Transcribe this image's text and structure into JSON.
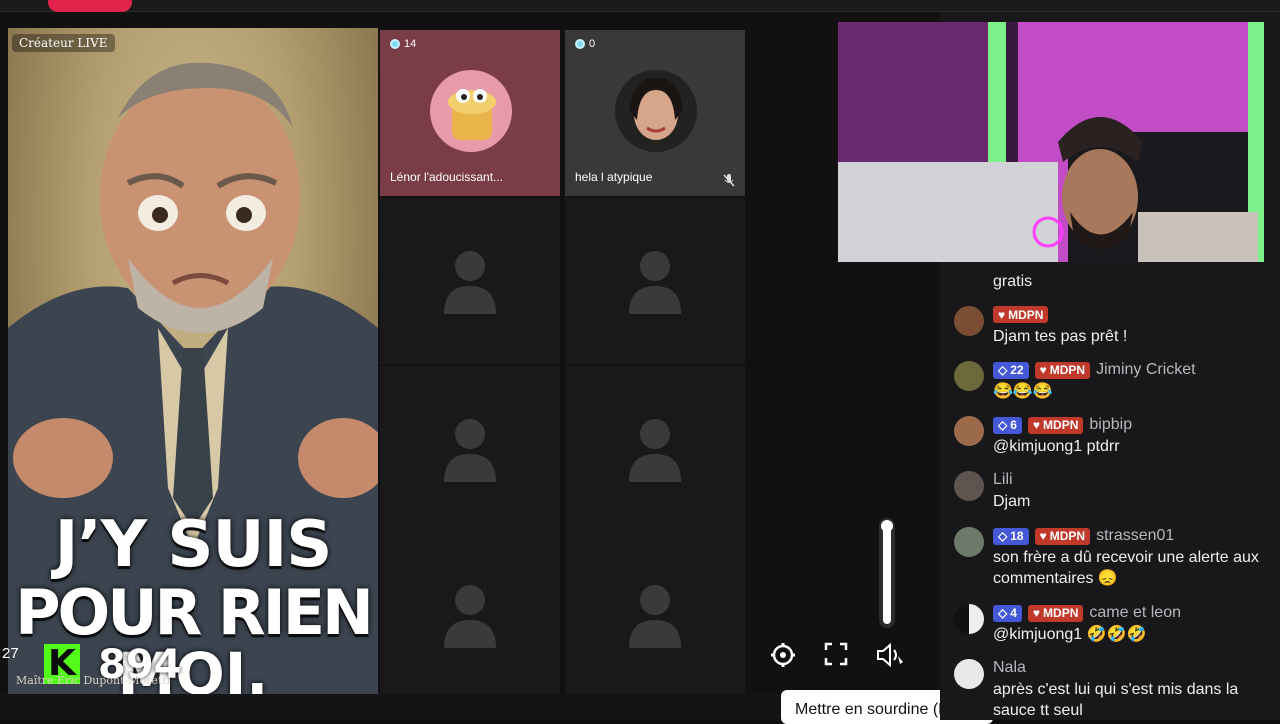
{
  "stage": {
    "host_label": "Créateur LIVE",
    "host_caption_line1": "J’Y SUIS",
    "host_caption_line2": "POUR RIEN",
    "host_caption_line3": "MOI.",
    "score": "27",
    "k_badge": "K",
    "viewers": "894",
    "host_name": "Maître Éric Dupont-Moretti",
    "guests": [
      {
        "count": "14",
        "name": "Lénor l'adoucissant..."
      },
      {
        "count": "0",
        "name": "hela l atypique"
      }
    ],
    "volume_level": 1.0,
    "tooltip": "Mettre en sourdine (M)",
    "colors": {
      "accent": "#e0244c",
      "kick_green": "#53fc18"
    }
  },
  "chat": {
    "partial": {
      "text": "gratis"
    },
    "messages": [
      {
        "badges": [
          "MDPN"
        ],
        "sub": "",
        "user": "",
        "text": "Djam tes pas prêt !"
      },
      {
        "sub": "22",
        "badges": [
          "MDPN"
        ],
        "user": "Jiminy Cricket",
        "text": "😂😂😂"
      },
      {
        "sub": "6",
        "badges": [
          "MDPN"
        ],
        "user": "bipbip",
        "text": "@kimjuong1 ptdrr"
      },
      {
        "sub": "",
        "badges": [],
        "user": "Lili",
        "text": "Djam"
      },
      {
        "sub": "18",
        "badges": [
          "MDPN"
        ],
        "user": "strassen01",
        "text": "son frère a dû recevoir une alerte aux commentaires 😞"
      },
      {
        "sub": "4",
        "badges": [
          "MDPN"
        ],
        "user": "came et leon",
        "text": "@kimjuong1 🤣🤣🤣"
      },
      {
        "sub": "",
        "badges": [],
        "user": "Nala",
        "text": "après c'est lui qui s'est mis dans la sauce tt seul"
      }
    ],
    "badge_label": "MDPN",
    "icons": [
      "heart-icon",
      "diamond-icon",
      "settings-icon",
      "fullscreen-icon",
      "volume-icon"
    ]
  }
}
